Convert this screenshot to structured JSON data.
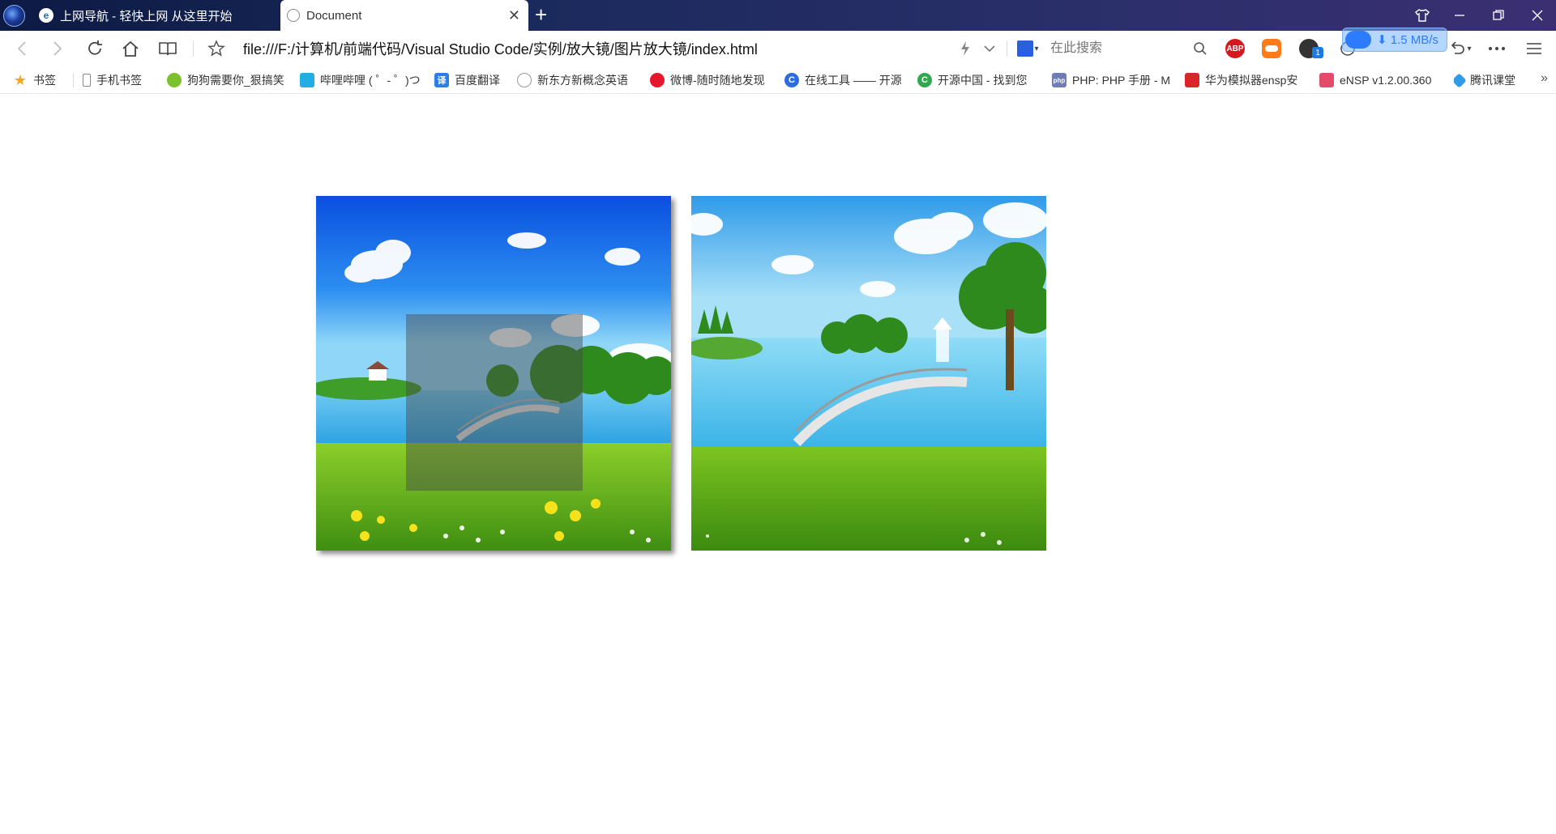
{
  "browser": {
    "tabs": [
      {
        "label": "上网导航 - 轻快上网 从这里开始",
        "active": false,
        "icon": "browser-e-icon"
      },
      {
        "label": "Document",
        "active": true,
        "icon": "globe-icon"
      }
    ],
    "new_tab_glyph": "+",
    "address": "file:///F:/计算机/前端代码/Visual Studio Code/实例/放大镜/图片放大镜/index.html",
    "search_placeholder": "在此搜索",
    "extensions": {
      "abp_label": "ABP",
      "badge_count": "1",
      "download_speed": "⬇ 1.5 MB/s"
    }
  },
  "bookmarks": [
    {
      "label": "书签",
      "icon": "star-icon",
      "color": "#f5a623"
    },
    {
      "label": "手机书签",
      "icon": "phone-icon",
      "color": "#888888"
    },
    {
      "label": "狗狗需要你_狠搞笑",
      "icon": "dog-icon",
      "color": "#7cc12b"
    },
    {
      "label": "哔哩哔哩 ( ゜- ゜)つ",
      "icon": "bilibili-icon",
      "color": "#23ade5"
    },
    {
      "label": "百度翻译",
      "icon": "translate-icon",
      "color": "#2b7de9"
    },
    {
      "label": "新东方新概念英语",
      "icon": "globe-icon",
      "color": "#999999"
    },
    {
      "label": "微博-随时随地发现",
      "icon": "weibo-icon",
      "color": "#e6162d"
    },
    {
      "label": "在线工具 —— 开源",
      "icon": "tool-icon",
      "color": "#2b6de0"
    },
    {
      "label": "开源中国 - 找到您",
      "icon": "oschina-icon",
      "color": "#2fa84f"
    },
    {
      "label": "PHP: PHP 手册 - M",
      "icon": "php-icon",
      "color": "#6f7cb5"
    },
    {
      "label": "华为模拟器ensp安",
      "icon": "huawei-icon",
      "color": "#d9252a"
    },
    {
      "label": "eNSP v1.2.00.360",
      "icon": "ensp-icon",
      "color": "#e34b6b"
    },
    {
      "label": "腾讯课堂",
      "icon": "tencent-class-icon",
      "color": "#2f9be8"
    }
  ],
  "bookmarks_more": "»",
  "colors": {
    "titlebar": "#1b2a5c",
    "sky_top": "#0a4fe0",
    "sky_light": "#7fd0f5",
    "lake": "#3bb8e8",
    "grass": "#5fae1c",
    "lens_overlay": "rgba(70,70,70,0.45)"
  },
  "magnifier": {
    "lens_fraction": {
      "size": 0.5
    }
  }
}
